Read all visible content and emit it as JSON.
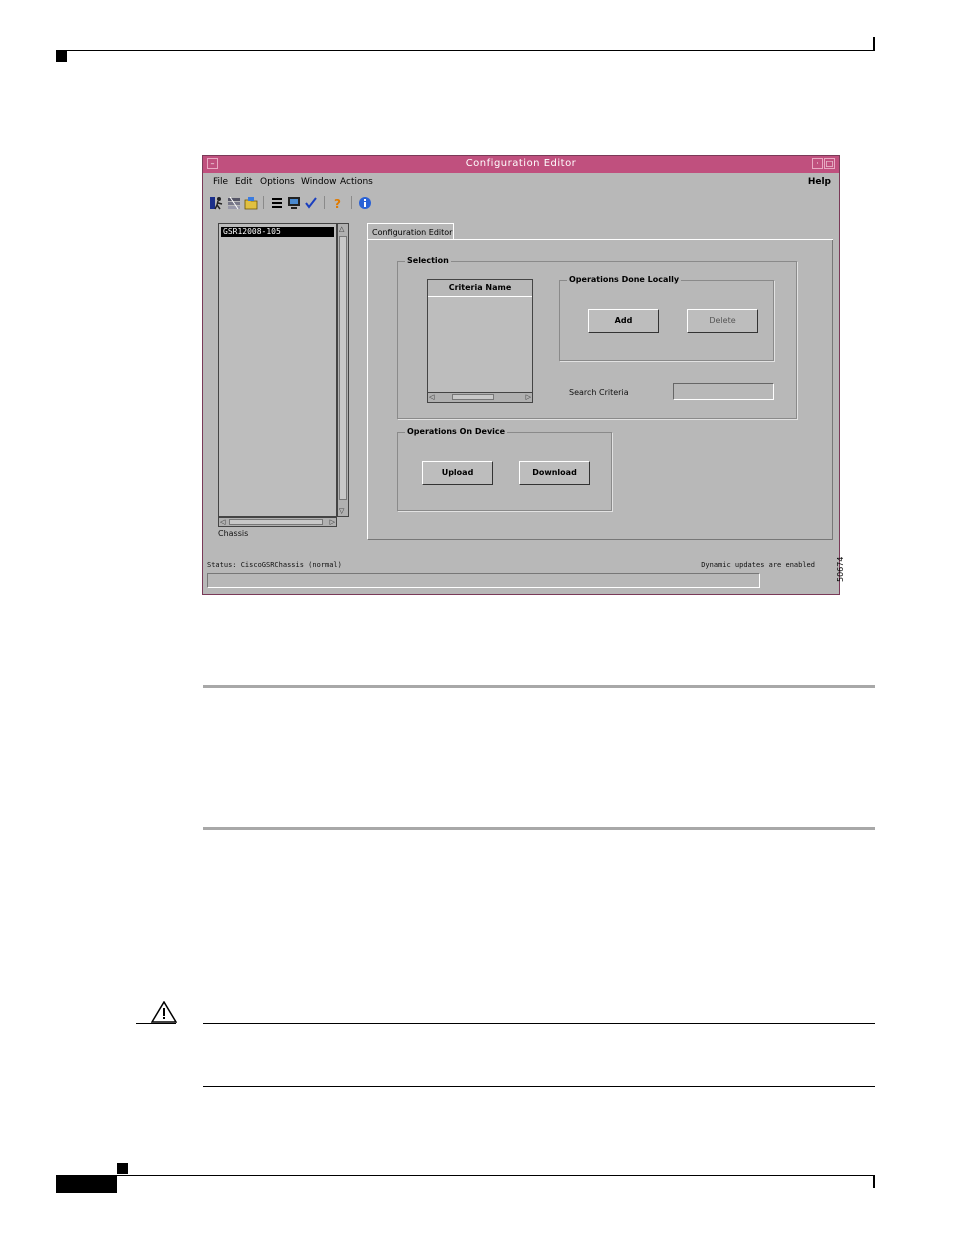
{
  "window": {
    "title": "Configuration Editor",
    "minimize_glyph": "·",
    "restore_glyph": "□"
  },
  "menubar": {
    "file": "File",
    "edit": "Edit",
    "options": "Options",
    "window": "Window",
    "actions": "Actions",
    "help": "Help"
  },
  "toolbar": {
    "icons": [
      "exit-icon",
      "deploy-icon",
      "open-folder-icon",
      "list-icon",
      "monitor-icon",
      "check-icon",
      "help-question-icon",
      "info-icon"
    ]
  },
  "tree": {
    "selected_item": "GSR12008-105",
    "label": "Chassis"
  },
  "tab": {
    "label": "Configuration Editor"
  },
  "selection": {
    "group_label": "Selection",
    "list_header": "Criteria Name",
    "search_label": "Search Criteria",
    "search_value": ""
  },
  "local_ops": {
    "group_label": "Operations Done Locally",
    "add": "Add",
    "delete": "Delete"
  },
  "device_ops": {
    "group_label": "Operations On Device",
    "upload": "Upload",
    "download": "Download"
  },
  "status": {
    "left": "Status: CiscoGSRChassis (normal)",
    "right": "Dynamic updates are enabled"
  },
  "figure_number": "50674",
  "colors": {
    "titlebar": "#c0507e",
    "window_bg": "#b8b8b8"
  }
}
